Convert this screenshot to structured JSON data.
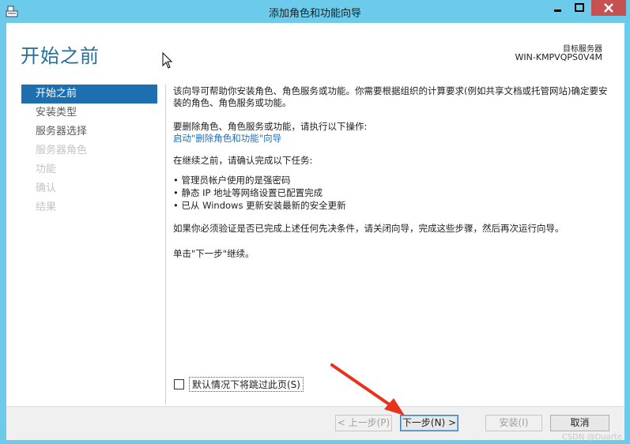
{
  "window": {
    "title": "添加角色和功能向导",
    "controls": {
      "min": "minimize-icon",
      "max": "maximize-icon",
      "close": "close-icon"
    }
  },
  "header": {
    "page_title": "开始之前",
    "target_server_label": "目标服务器",
    "target_server_value": "WIN-KMPVQPS0V4M"
  },
  "nav": {
    "items": [
      {
        "label": "开始之前",
        "state": "active"
      },
      {
        "label": "安装类型",
        "state": "enabled"
      },
      {
        "label": "服务器选择",
        "state": "enabled"
      },
      {
        "label": "服务器角色",
        "state": "disabled"
      },
      {
        "label": "功能",
        "state": "disabled"
      },
      {
        "label": "确认",
        "state": "disabled"
      },
      {
        "label": "结果",
        "state": "disabled"
      }
    ]
  },
  "content": {
    "intro": "该向导可帮助你安装角色、角色服务或功能。你需要根据组织的计算要求(例如共享文档或托管网站)确定要安装的角色、角色服务或功能。",
    "remove_text": "要删除角色、角色服务或功能，请执行以下操作:",
    "remove_link": "启动\"删除角色和功能\"向导",
    "before_text": "在继续之前，请确认完成以下任务:",
    "bullets": [
      "管理员帐户使用的是强密码",
      "静态 IP 地址等网络设置已配置完成",
      "已从 Windows 更新安装最新的安全更新"
    ],
    "verify_text": "如果你必须验证是否已完成上述任何先决条件，请关闭向导，完成这些步骤，然后再次运行向导。",
    "click_text": "单击\"下一步\"继续。"
  },
  "skip": {
    "label": "默认情况下将跳过此页(S)",
    "checked": false
  },
  "footer": {
    "prev": "< 上一步(P)",
    "next": "下一步(N) >",
    "install": "安装(I)",
    "cancel": "取消"
  },
  "watermark": "CSDN @Duarte",
  "colors": {
    "titlebar": "#6ccbea",
    "accent": "#1e6fb0",
    "title": "#1f6f9a",
    "arrow": "#e8321c",
    "close": "#c75050"
  }
}
